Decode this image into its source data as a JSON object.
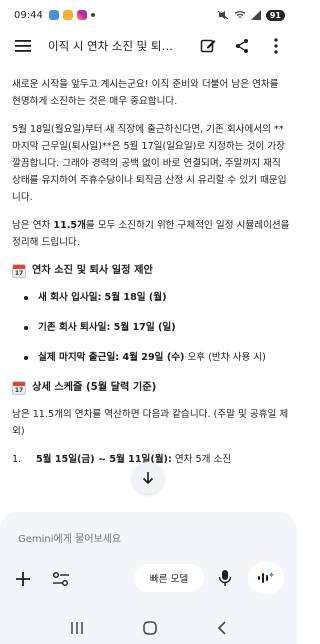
{
  "status_bar": {
    "time": "09:44",
    "battery": "91",
    "icons": [
      "sim-icon",
      "app-icon",
      "instagram-icon",
      "mute-icon",
      "wifi-icon",
      "signal-icon",
      "battery-icon"
    ]
  },
  "header": {
    "title": "이직 시 연차 소진 및 퇴사...",
    "icons": [
      "menu-icon",
      "edit-icon",
      "share-icon",
      "more-icon"
    ]
  },
  "content": {
    "para1": "새로운 시작을 앞두고 계시는군요! 이직 준비와 더불어 남은 연차를 현명하게 소진하는 것은 매우 중요합니다.",
    "para2": "5월 18일(월요일)부터 새 직장에 출근하신다면, 기존 회사에서의 **마지막 근무일(퇴사일)**은 5월 17일(일요일)로 지정하는 것이 가장 깔끔합니다. 그래야 경력의 공백 없이 바로 연결되며, 주말까지 재직 상태를 유지하여 주휴수당이나 퇴직금 산정 시 유리할 수 있기 때문입니다.",
    "para3_pre": "남은 연차 ",
    "para3_bold": "11.5개",
    "para3_post": "를 모두 소진하기 위한 구체적인 일정 시뮬레이션을 정리해 드립니다.",
    "heading1": "연차 소진 및 퇴사 일정 제안",
    "bullets": [
      {
        "label": "새 회사 입사일:",
        "value": "5월 18일 (월)",
        "rest": ""
      },
      {
        "label": "기존 회사 퇴사일: 5월 17일 (일)",
        "value": "",
        "rest": ""
      },
      {
        "label": "실제 마지막 출근일: 4월 29일 (수)",
        "value": "",
        "rest": " 오후 (반차 사용 시)"
      }
    ],
    "heading2": "상세 스케줄 (5월 달력 기준)",
    "para4": "남은 11.5개의 연차를 역산하면 다음과 같습니다. (주말 및 공휴일 제외)",
    "list_num": "1.",
    "list_bold": "5월 15일(금) ~ 5월 11일(월):",
    "list_rest": " 연차 5개 소진",
    "calendar_num": "17"
  },
  "input": {
    "placeholder": "Gemini에게 물어보세요",
    "model_label": "빠른 모델"
  },
  "nav": {
    "icons": [
      "recent-apps-icon",
      "home-icon",
      "back-icon"
    ]
  }
}
